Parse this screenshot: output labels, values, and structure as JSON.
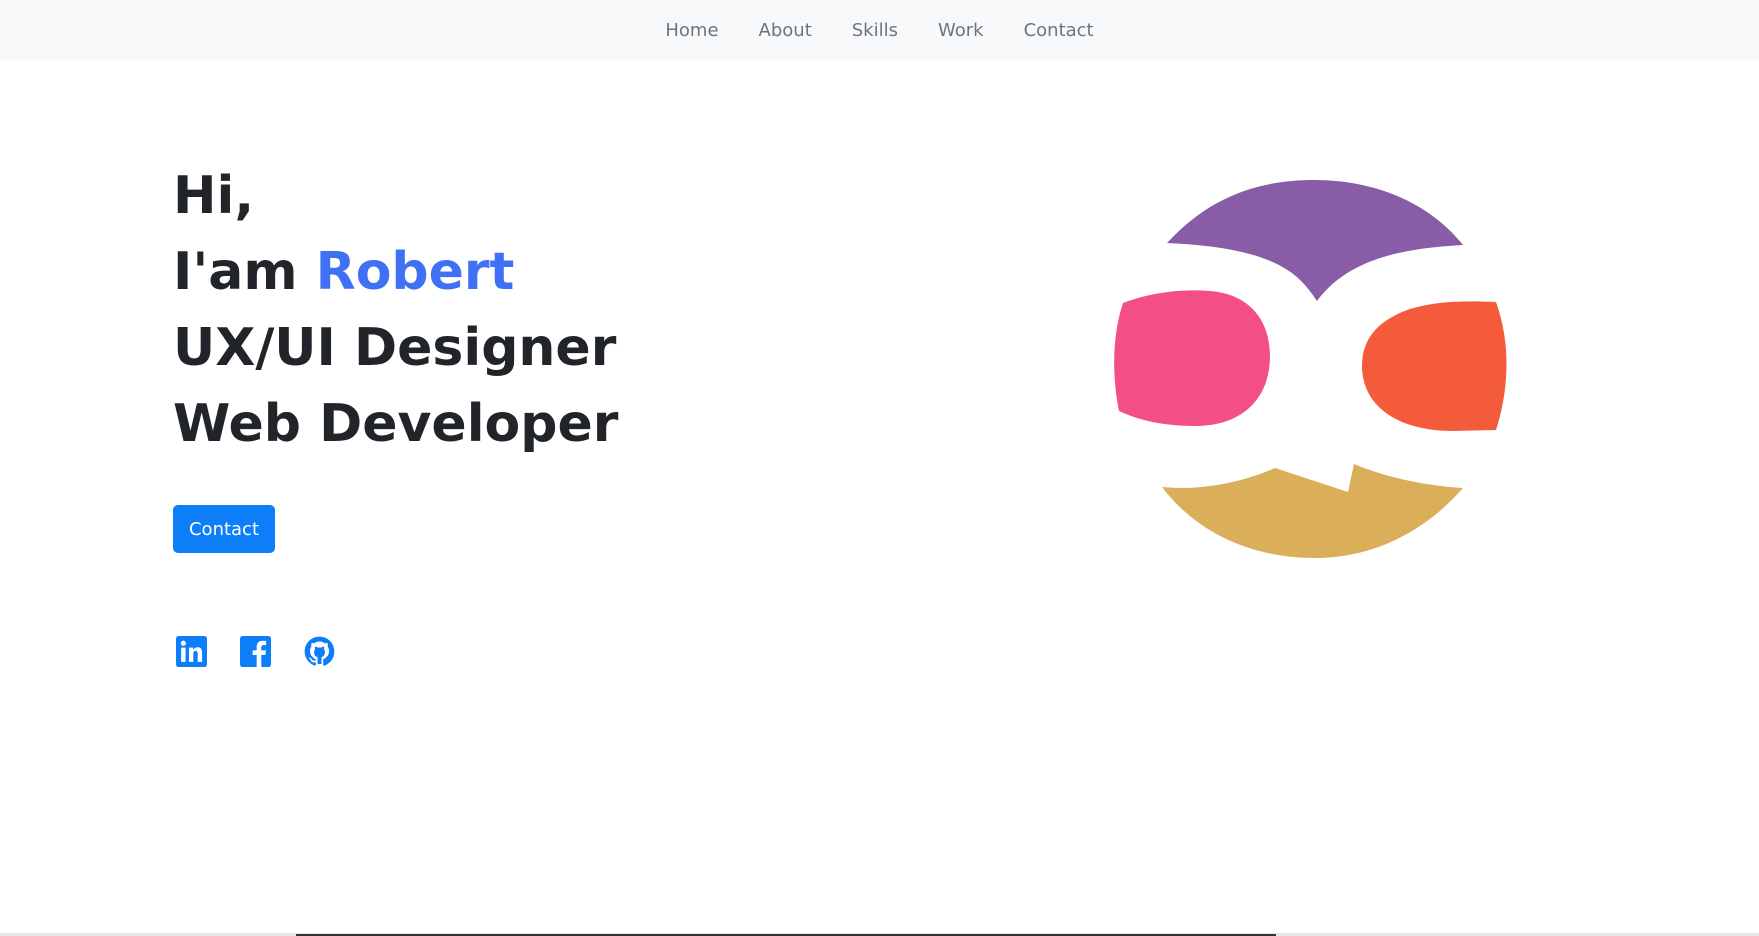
{
  "nav": {
    "items": [
      {
        "label": "Home"
      },
      {
        "label": "About"
      },
      {
        "label": "Skills"
      },
      {
        "label": "Work"
      },
      {
        "label": "Contact"
      }
    ]
  },
  "hero": {
    "greeting": "Hi,",
    "intro_prefix": "I'am ",
    "name": "Robert",
    "role_1": "UX/UI Designer",
    "role_2": "Web Developer",
    "contact_button": "Contact"
  },
  "socials": [
    {
      "icon": "linkedin-icon"
    },
    {
      "icon": "facebook-icon"
    },
    {
      "icon": "github-icon"
    }
  ],
  "colors": {
    "accent": "#4070f4",
    "button": "#0d7ef8",
    "nav_bg": "#f8f9fa",
    "logo_purple": "#885ca6",
    "logo_pink": "#f34e88",
    "logo_orange": "#f35b3a",
    "logo_gold": "#dbae5a"
  }
}
